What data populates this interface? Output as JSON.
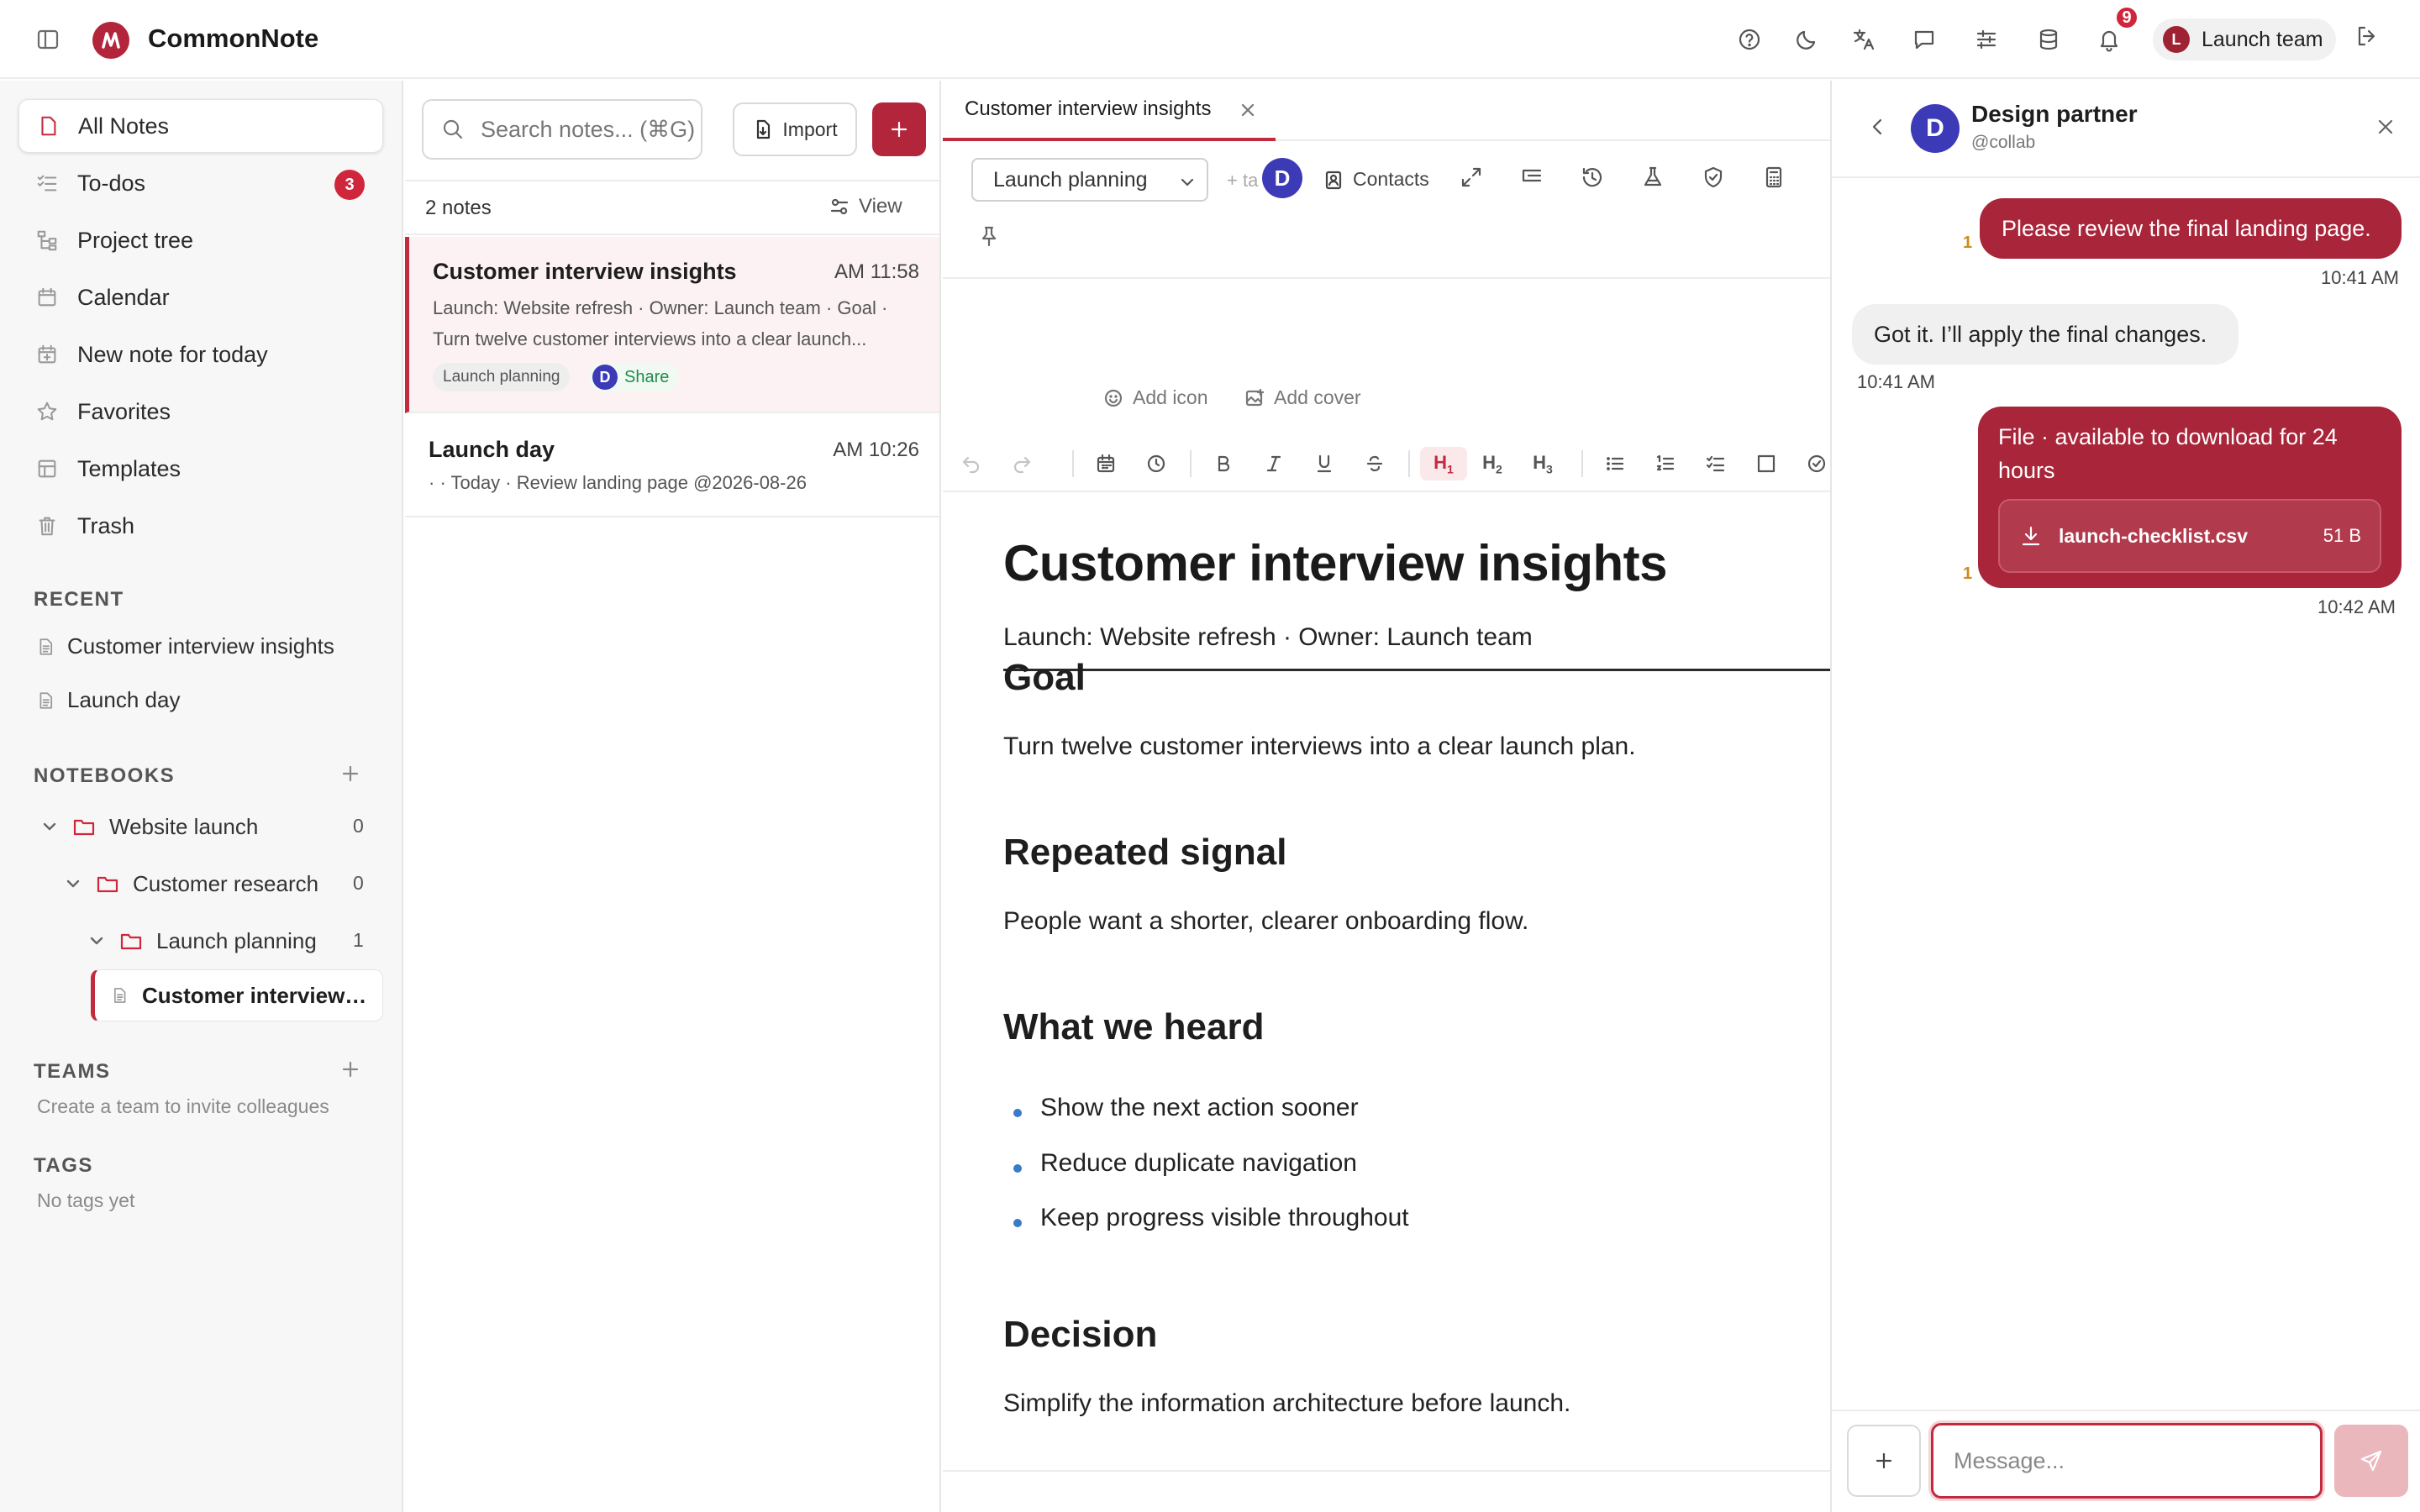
{
  "app": {
    "name": "CommonNote"
  },
  "topbar": {
    "icons": [
      "sidebar-toggle-icon",
      "help-icon",
      "moon-icon",
      "translate-icon",
      "chat-icon",
      "sliders-icon",
      "database-icon",
      "bell-icon",
      "logout-icon"
    ],
    "notifications_count": "9",
    "user": {
      "initial": "L",
      "label": "Launch team"
    }
  },
  "sidebar": {
    "nav": [
      {
        "label": "All Notes",
        "icon": "note-icon",
        "active": true
      },
      {
        "label": "To-dos",
        "icon": "checklist-icon",
        "badge": "3"
      },
      {
        "label": "Project tree",
        "icon": "tree-icon"
      },
      {
        "label": "Calendar",
        "icon": "calendar-icon"
      },
      {
        "label": "New note for today",
        "icon": "calendar-plus-icon"
      },
      {
        "label": "Favorites",
        "icon": "star-icon"
      },
      {
        "label": "Templates",
        "icon": "template-icon"
      },
      {
        "label": "Trash",
        "icon": "trash-icon"
      }
    ],
    "recent_title": "RECENT",
    "recent": [
      "Customer interview insights",
      "Launch day"
    ],
    "notebooks_title": "NOTEBOOKS",
    "notebooks": [
      {
        "label": "Website launch",
        "count": "0"
      },
      {
        "label": "Customer research",
        "count": "0"
      },
      {
        "label": "Launch planning",
        "count": "1"
      }
    ],
    "active_note": "Customer interview insights",
    "teams_title": "TEAMS",
    "teams_empty": "Create a team to invite colleagues",
    "tags_title": "TAGS",
    "tags_empty": "No tags yet"
  },
  "notelist": {
    "search_placeholder": "Search notes... (⌘G)",
    "import_label": "Import",
    "count_label": "2 notes",
    "view_label": "View",
    "notes": [
      {
        "title": "Customer interview insights",
        "time": "AM 11:58",
        "snippet": "Launch: Website refresh · Owner: Launch team · Goal · Turn twelve customer interviews into a clear launch...",
        "tag": "Launch planning",
        "share_initial": "D",
        "share_label": "Share"
      },
      {
        "title": "Launch day",
        "time": "AM 10:26",
        "snippet": "· · Today · Review landing page @2026-08-26"
      }
    ]
  },
  "editor": {
    "tab_title": "Customer interview insights",
    "notebook_select": "Launch planning",
    "tag_hint": "+ ta",
    "collab_initial": "D",
    "contacts_label": "Contacts",
    "add_icon_label": "Add icon",
    "add_cover_label": "Add cover",
    "format_buttons": [
      "undo",
      "redo",
      "date",
      "time",
      "bold",
      "italic",
      "underline",
      "strikethrough",
      "H1",
      "H2",
      "H3",
      "bullet-list",
      "numbered-list",
      "checklist",
      "box",
      "check"
    ],
    "doc": {
      "title": "Customer interview insights",
      "meta": "Launch: Website refresh · Owner: Launch team",
      "sections": [
        {
          "heading": "Goal",
          "text": "Turn twelve customer interviews into a clear launch plan."
        },
        {
          "heading": "Repeated signal",
          "text": "People want a shorter, clearer onboarding flow."
        },
        {
          "heading": "What we heard",
          "bullets": [
            "Show the next action sooner",
            "Reduce duplicate navigation",
            "Keep progress visible throughout"
          ]
        },
        {
          "heading": "Decision",
          "text": "Simplify the information architecture before launch."
        }
      ]
    }
  },
  "chat": {
    "contact": {
      "initial": "D",
      "name": "Design partner",
      "handle": "@collab"
    },
    "messages": [
      {
        "dir": "out",
        "text": "Please review the final landing page.",
        "time": "10:41 AM",
        "read": "1"
      },
      {
        "dir": "in",
        "text": "Got it. I’ll apply the final changes.",
        "time": "10:41 AM"
      },
      {
        "dir": "out",
        "text": "File · available to download for 24 hours",
        "file_name": "launch-checklist.csv",
        "file_size": "51 B",
        "time": "10:42 AM",
        "read": "1"
      }
    ],
    "input_placeholder": "Message..."
  },
  "colors": {
    "accent": "#b3253a",
    "badge": "#d0263b",
    "avatar_blue": "#3d3ab8",
    "link_green": "#1f8b4c"
  }
}
